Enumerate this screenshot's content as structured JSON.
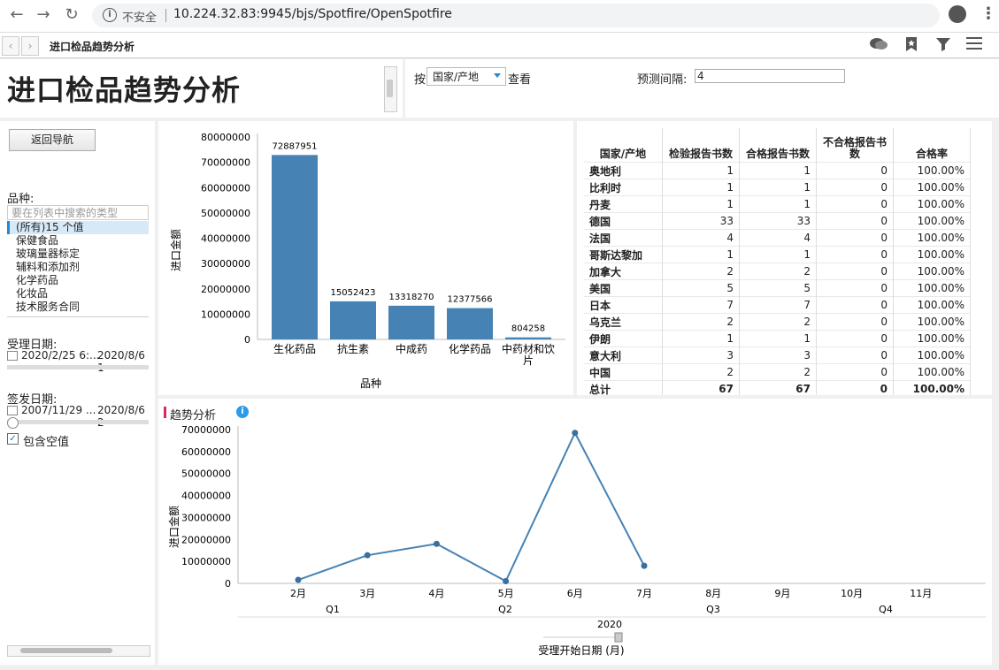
{
  "browser": {
    "insecure_label": "不安全",
    "url": "10.224.32.83:9945/bjs/Spotfire/OpenSpotfire"
  },
  "tab": {
    "title": "进口检品趋势分析"
  },
  "title_panel": {
    "title": "进口检品趋势分析"
  },
  "controls": {
    "by_label": "按",
    "country_select": "国家/产地",
    "view_label": "查看",
    "forecast_label": "预测间隔:",
    "forecast_value": "4"
  },
  "filters": {
    "back_button": "返回导航",
    "variety_label": "品种:",
    "search_placeholder": "要在列表中搜索的类型",
    "list_items": [
      "(所有)15 个值",
      "保健食品",
      "玻璃量器标定",
      "辅料和添加剂",
      "化学药品",
      "化妆品",
      "技术服务合同"
    ],
    "accept_date_label": "受理日期:",
    "accept_date_from": "2020/2/25 6:...",
    "accept_date_to": "2020/8/6 1",
    "issue_date_label": "签发日期:",
    "issue_date_from": "2007/11/29 ...",
    "issue_date_to": "2020/8/6 2",
    "include_empty": "包含空值"
  },
  "bar_chart": {
    "chart_data": {
      "type": "bar",
      "categories": [
        "生化药品",
        "抗生素",
        "中成药",
        "化学药品",
        "中药材和饮片"
      ],
      "values": [
        72887951,
        15052423,
        13318270,
        12377566,
        804258
      ],
      "xlabel": "品种",
      "ylabel": "进口金额",
      "ylim": [
        0,
        80000000
      ],
      "yticks": [
        0,
        10000000,
        20000000,
        30000000,
        40000000,
        50000000,
        60000000,
        70000000,
        80000000
      ],
      "color": "#4682b4"
    }
  },
  "table": {
    "headers": [
      "国家/产地",
      "检验报告书数",
      "合格报告书数",
      "不合格报告书数",
      "合格率"
    ],
    "rows": [
      [
        "奥地利",
        "1",
        "1",
        "0",
        "100.00%"
      ],
      [
        "比利时",
        "1",
        "1",
        "0",
        "100.00%"
      ],
      [
        "丹麦",
        "1",
        "1",
        "0",
        "100.00%"
      ],
      [
        "德国",
        "33",
        "33",
        "0",
        "100.00%"
      ],
      [
        "法国",
        "4",
        "4",
        "0",
        "100.00%"
      ],
      [
        "哥斯达黎加",
        "1",
        "1",
        "0",
        "100.00%"
      ],
      [
        "加拿大",
        "2",
        "2",
        "0",
        "100.00%"
      ],
      [
        "美国",
        "5",
        "5",
        "0",
        "100.00%"
      ],
      [
        "日本",
        "7",
        "7",
        "0",
        "100.00%"
      ],
      [
        "乌克兰",
        "2",
        "2",
        "0",
        "100.00%"
      ],
      [
        "伊朗",
        "1",
        "1",
        "0",
        "100.00%"
      ],
      [
        "意大利",
        "3",
        "3",
        "0",
        "100.00%"
      ],
      [
        "中国",
        "2",
        "2",
        "0",
        "100.00%"
      ],
      [
        "总计",
        "67",
        "67",
        "0",
        "100.00%"
      ]
    ]
  },
  "trend_chart": {
    "title": "趋势分析",
    "chart_data": {
      "type": "line",
      "x": [
        "2月",
        "3月",
        "4月",
        "5月",
        "6月",
        "7月",
        "8月",
        "9月",
        "10月",
        "11月"
      ],
      "values": [
        1600000,
        12800000,
        18000000,
        1000000,
        68500000,
        8000000,
        null,
        null,
        null,
        null
      ],
      "quarters": [
        "Q1",
        "Q2",
        "Q3",
        "Q4"
      ],
      "year": "2020",
      "xlabel": "受理开始日期 (月)",
      "ylabel": "进口金额",
      "ylim": [
        0,
        70000000
      ],
      "yticks": [
        0,
        10000000,
        20000000,
        30000000,
        40000000,
        50000000,
        60000000,
        70000000
      ],
      "color": "#4682b4"
    }
  }
}
